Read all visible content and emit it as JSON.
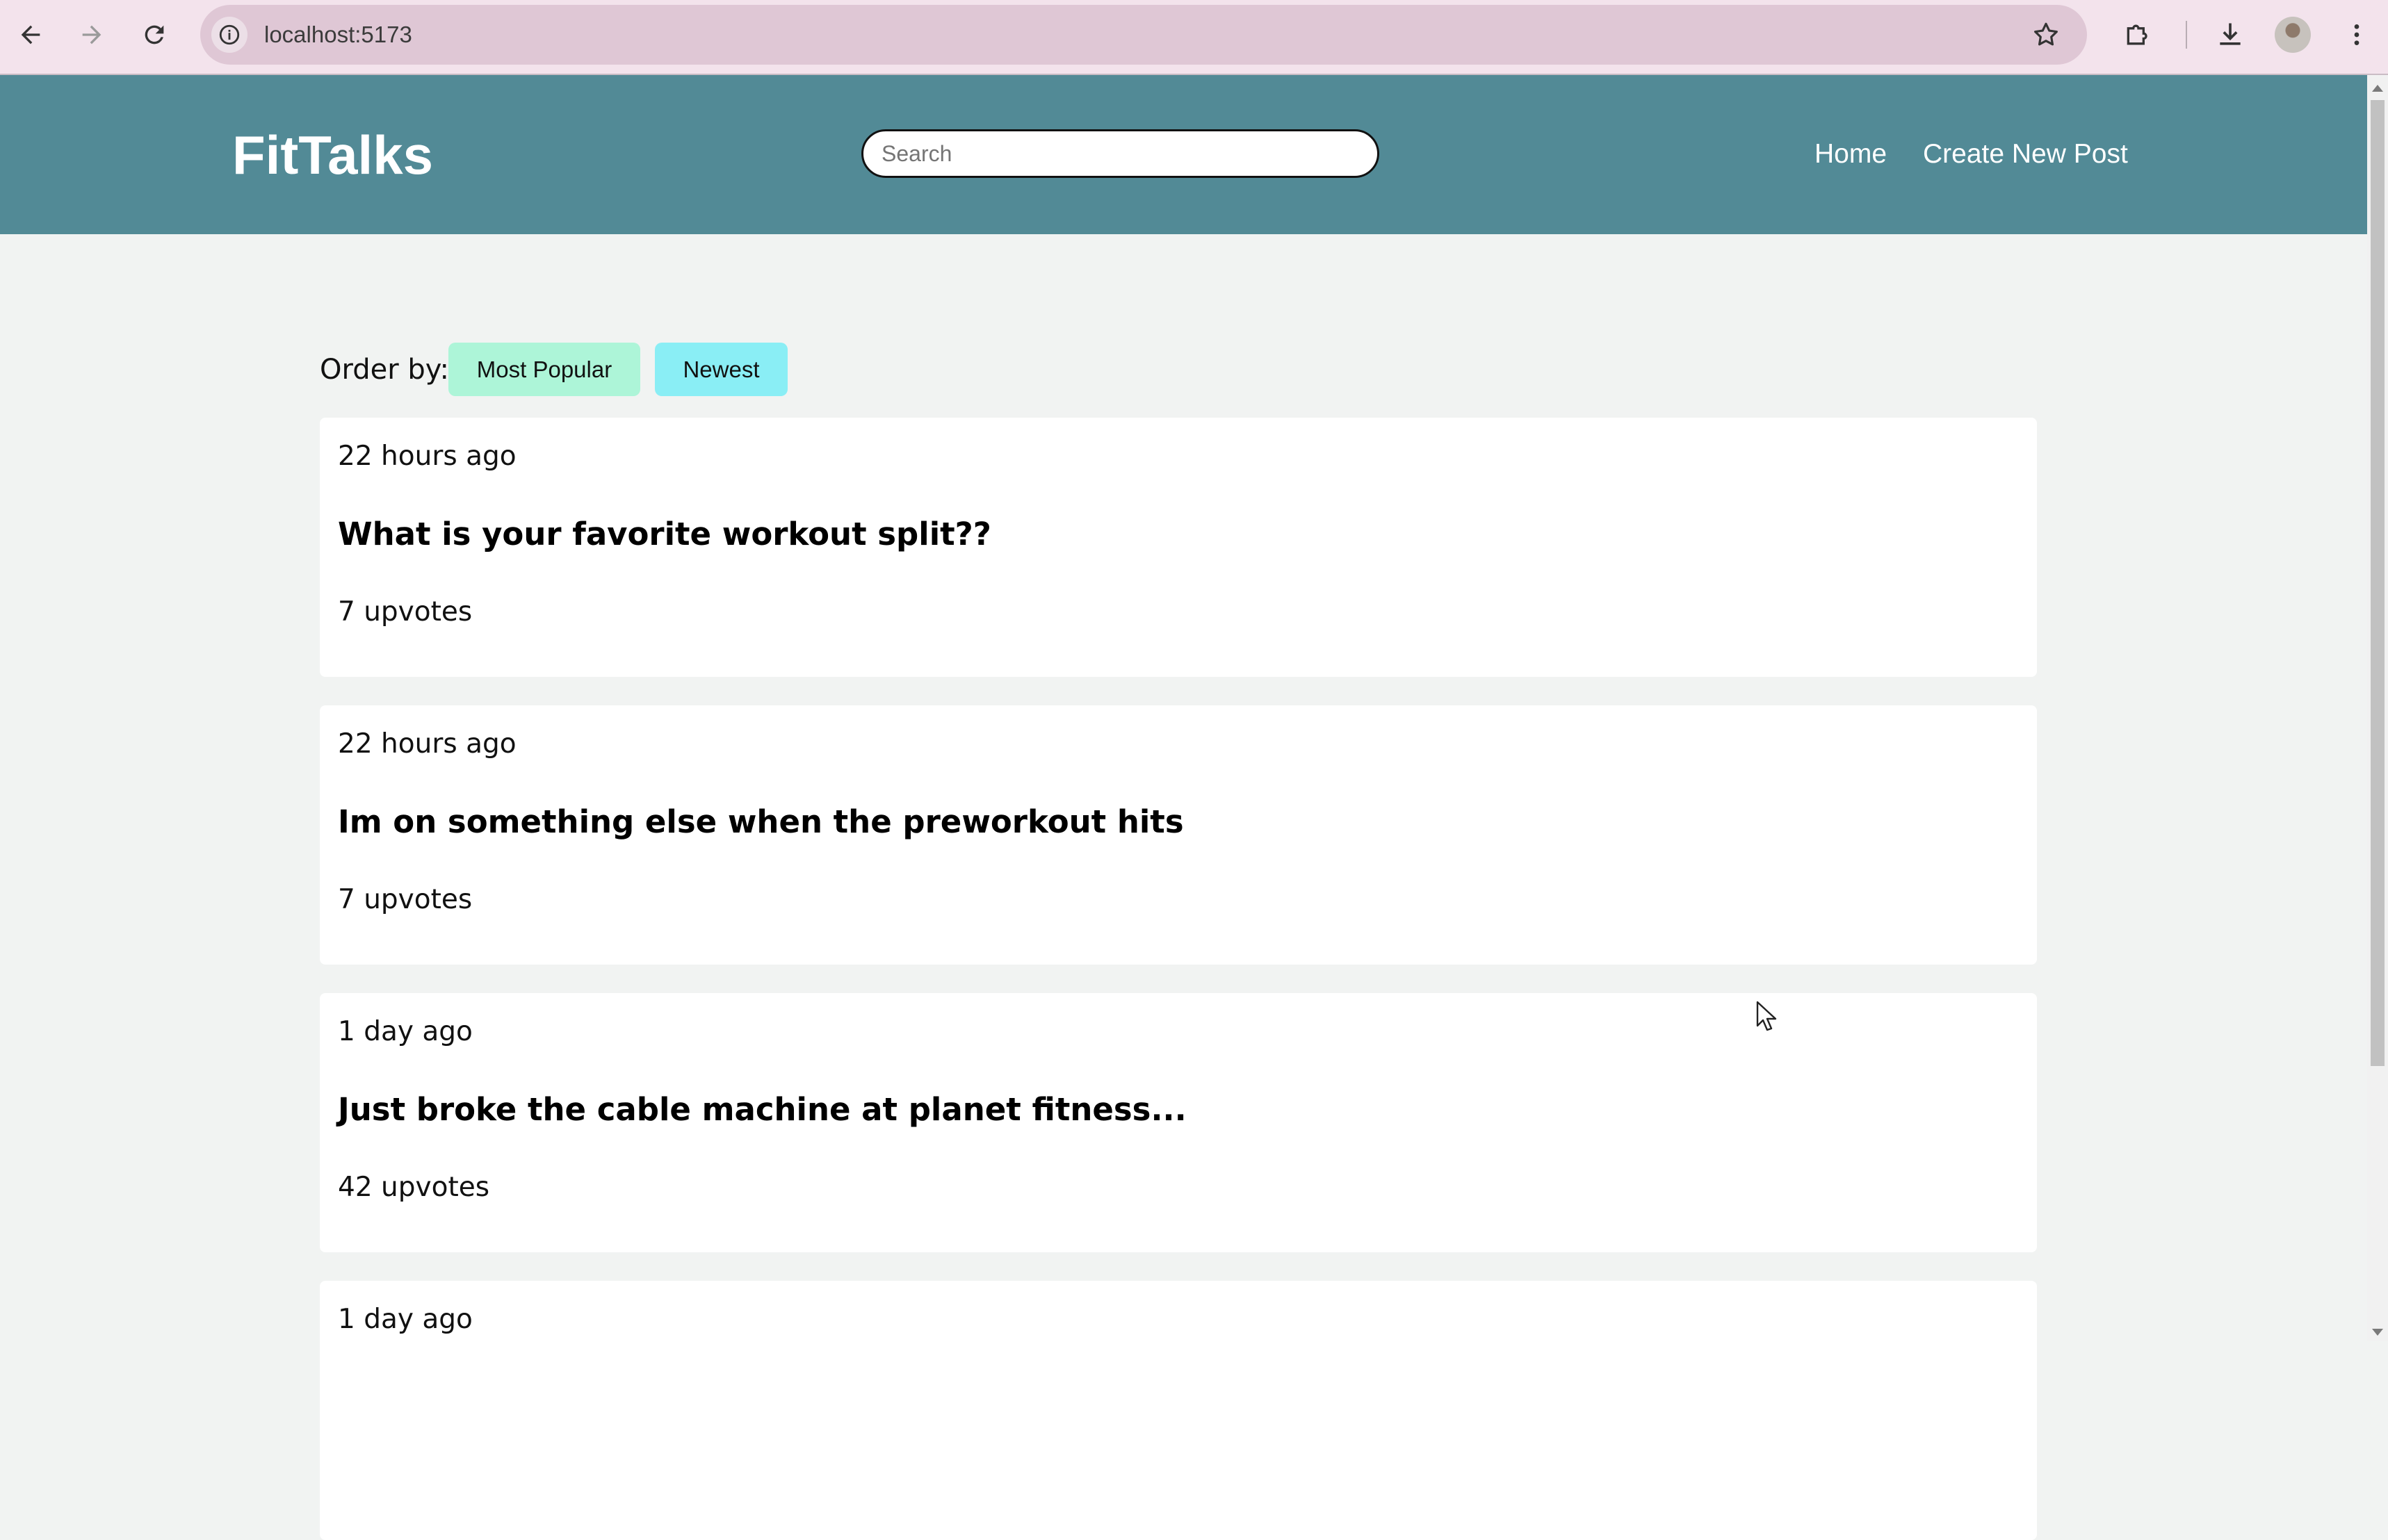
{
  "browser": {
    "url": "localhost:5173"
  },
  "header": {
    "logo": "FitTalks",
    "search_placeholder": "Search",
    "nav": [
      "Home",
      "Create New Post"
    ]
  },
  "order_by": {
    "label": "Order by:",
    "options": [
      "Most Popular",
      "Newest"
    ],
    "colors": {
      "most_popular": "#adf5d8",
      "newest": "#8aeef5"
    }
  },
  "posts": [
    {
      "time": "22 hours ago",
      "title": "What is your favorite workout split??",
      "upvotes": "7 upvotes"
    },
    {
      "time": "22 hours ago",
      "title": "Im on something else when the preworkout hits",
      "upvotes": "7 upvotes"
    },
    {
      "time": "1 day ago",
      "title": "Just broke the cable machine at planet fitness...",
      "upvotes": "42 upvotes"
    },
    {
      "time": "1 day ago"
    }
  ],
  "colors": {
    "header_bg": "#528a96",
    "page_bg": "#f1f3f2",
    "chrome_bg": "#f3e3ec"
  }
}
